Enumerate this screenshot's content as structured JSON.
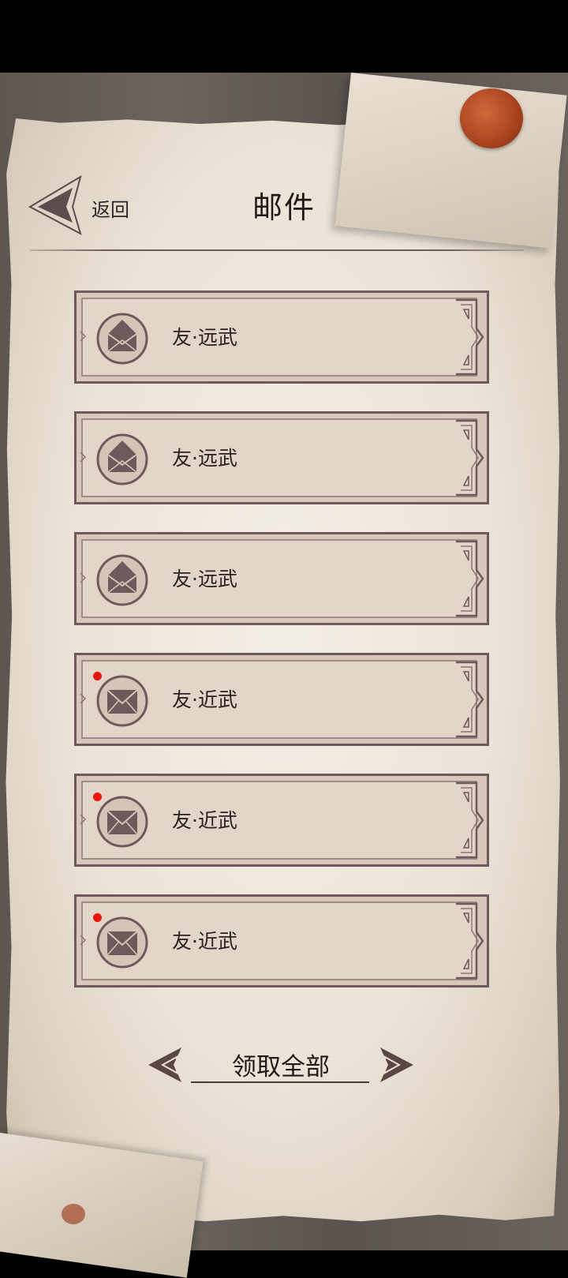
{
  "header": {
    "back_label": "返回",
    "title": "邮件"
  },
  "mails": [
    {
      "sender": "友·远武",
      "read": true
    },
    {
      "sender": "友·远武",
      "read": true
    },
    {
      "sender": "友·远武",
      "read": true
    },
    {
      "sender": "友·近武",
      "read": false
    },
    {
      "sender": "友·近武",
      "read": false
    },
    {
      "sender": "友·近武",
      "read": false
    }
  ],
  "footer": {
    "claim_all_label": "领取全部"
  },
  "colors": {
    "frame": "#6e5a5c",
    "row_fill": "#e0d0c2",
    "unread_dot": "#e8140e",
    "title_text": "#1f1a18"
  },
  "icons": {
    "back": "back-arrow-icon",
    "mail_read": "envelope-open-icon",
    "mail_unread": "envelope-closed-icon",
    "claim_prev": "arrow-left-icon",
    "claim_next": "arrow-right-icon"
  }
}
